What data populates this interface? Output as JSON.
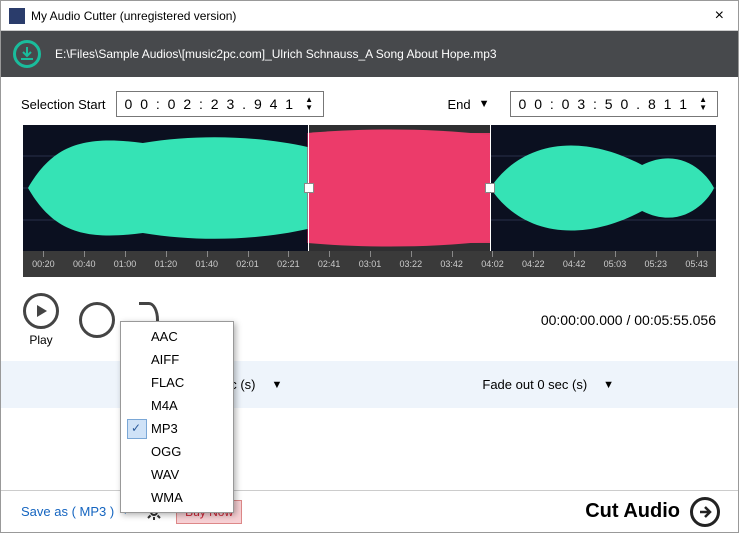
{
  "window": {
    "title": "My Audio Cutter (unregistered version)"
  },
  "file": {
    "path": "E:\\Files\\Sample Audios\\[music2pc.com]_Ulrich Schnauss_A Song About Hope.mp3"
  },
  "selection": {
    "start_label": "Selection Start",
    "start_value": "0 0 : 0 2 : 2 3 . 9 4 1",
    "end_label": "End",
    "end_value": "0 0 : 0 3 : 5 0 . 8 1 1"
  },
  "ruler_ticks": [
    "00:20",
    "00:40",
    "01:00",
    "01:20",
    "01:40",
    "02:01",
    "02:21",
    "02:41",
    "03:01",
    "03:22",
    "03:42",
    "04:02",
    "04:22",
    "04:42",
    "05:03",
    "05:23",
    "05:43"
  ],
  "playback": {
    "play_label": "Play",
    "time_display": "00:00:00.000 / 00:05:55.056"
  },
  "fade": {
    "in_label": "ec (s)",
    "out_label": "Fade out 0 sec (s)"
  },
  "formats": [
    "AAC",
    "AIFF",
    "FLAC",
    "M4A",
    "MP3",
    "OGG",
    "WAV",
    "WMA"
  ],
  "selected_format": "MP3",
  "bottom": {
    "save_as": "Save as ( MP3 )",
    "buy_now": "Buy Now",
    "cut_audio": "Cut Audio"
  }
}
